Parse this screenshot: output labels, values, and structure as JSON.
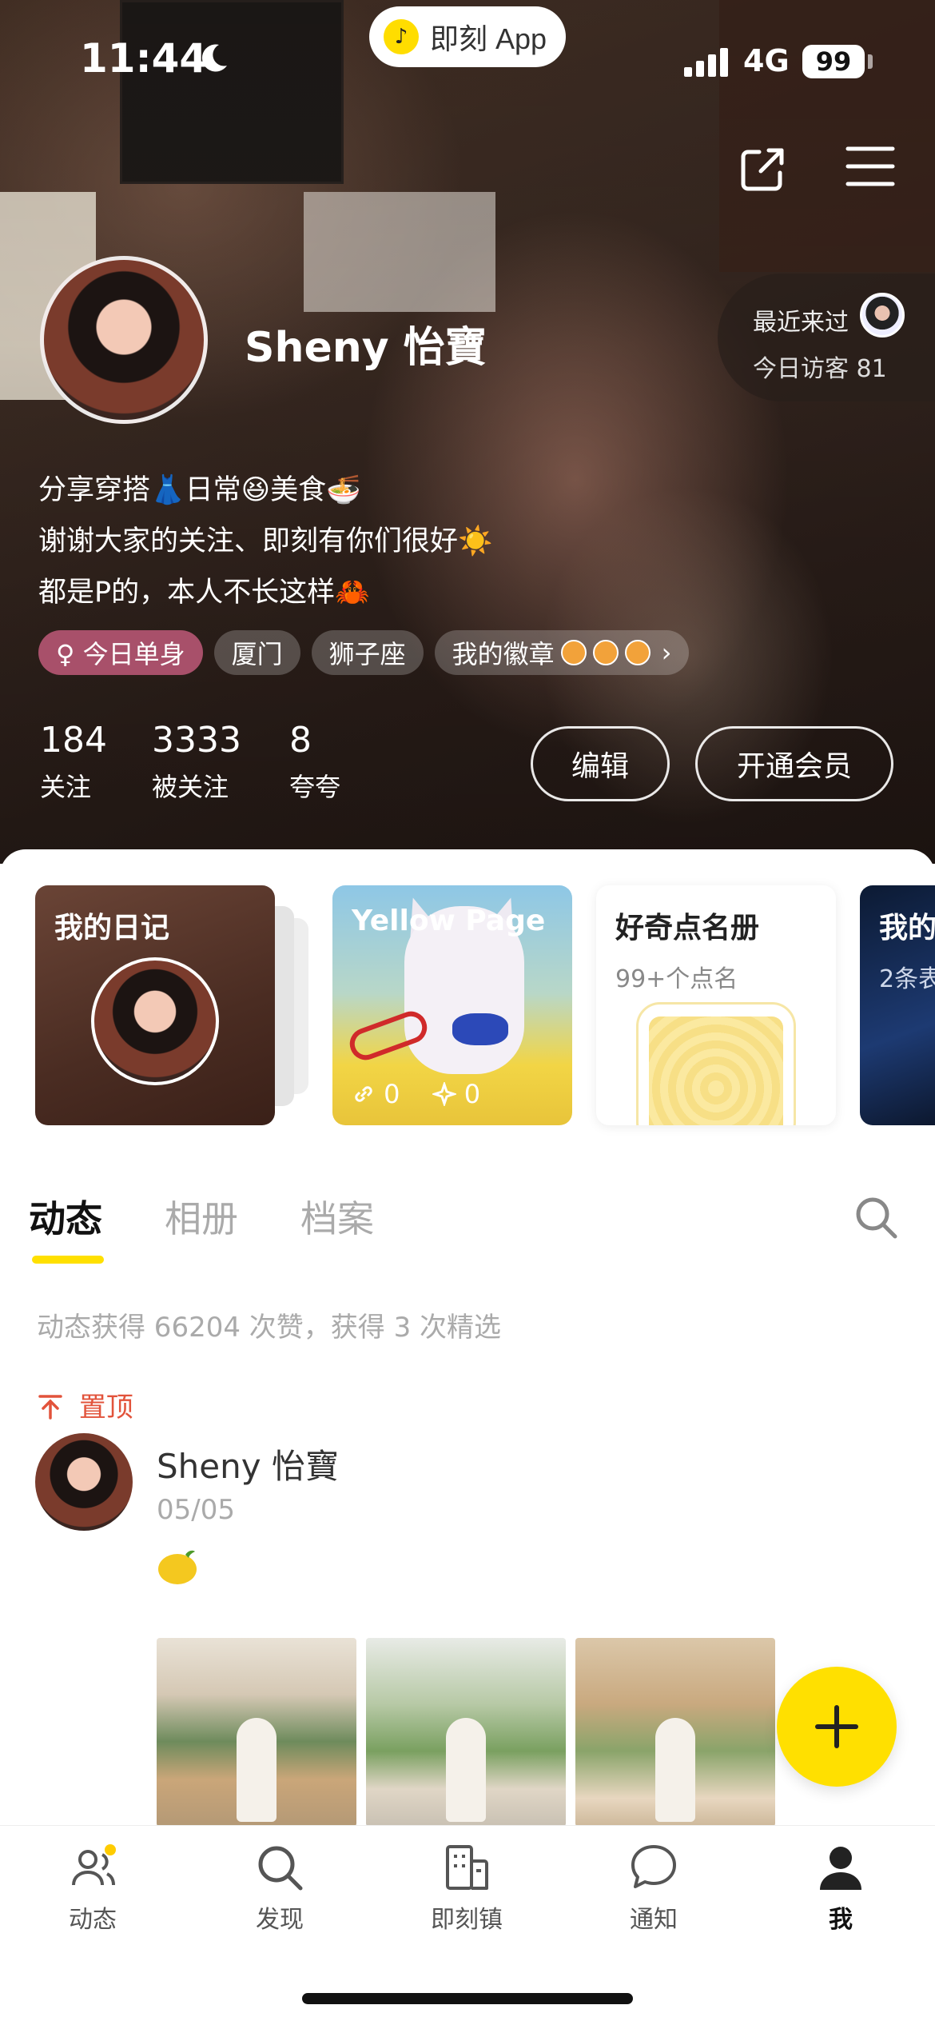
{
  "status_bar": {
    "time": "11:44",
    "network": "4G",
    "battery": "99"
  },
  "app_pill": {
    "label": "即刻 App"
  },
  "profile": {
    "name": "Sheny 怡寶",
    "visitors_line1": "最近来过",
    "visitors_line2": "今日访客 81",
    "bio": [
      "分享穿搭👗日常😆美食🍜",
      "谢谢大家的关注、即刻有你们很好☀️",
      "都是P的，本人不长这样🦀"
    ],
    "tags": {
      "single": "♀ 今日单身",
      "city": "厦门",
      "zodiac": "狮子座",
      "badges": "我的徽章"
    },
    "stats": [
      {
        "num": "184",
        "label": "关注"
      },
      {
        "num": "3333",
        "label": "被关注"
      },
      {
        "num": "8",
        "label": "夸夸"
      }
    ],
    "edit_label": "编辑",
    "vip_label": "开通会员"
  },
  "cards": {
    "diary_title": "我的日记",
    "yellow_title": "Yellow Page",
    "yellow_links": "0",
    "yellow_stars": "0",
    "curious_title": "好奇点名册",
    "curious_sub": "99+个点名",
    "mine_title": "我的",
    "mine_sub": "2条表"
  },
  "tabs": [
    "动态",
    "相册",
    "档案"
  ],
  "feed": {
    "likes_text": "动态获得 66204 次赞，获得 3 次精选",
    "pinned": "置顶",
    "post_name": "Sheny 怡寶",
    "post_date": "05/05"
  },
  "nav": [
    "动态",
    "发现",
    "即刻镇",
    "通知",
    "我"
  ],
  "colors": {
    "accent": "#ffe000",
    "pin": "#e2533b",
    "single_tag": "#a8506a"
  }
}
